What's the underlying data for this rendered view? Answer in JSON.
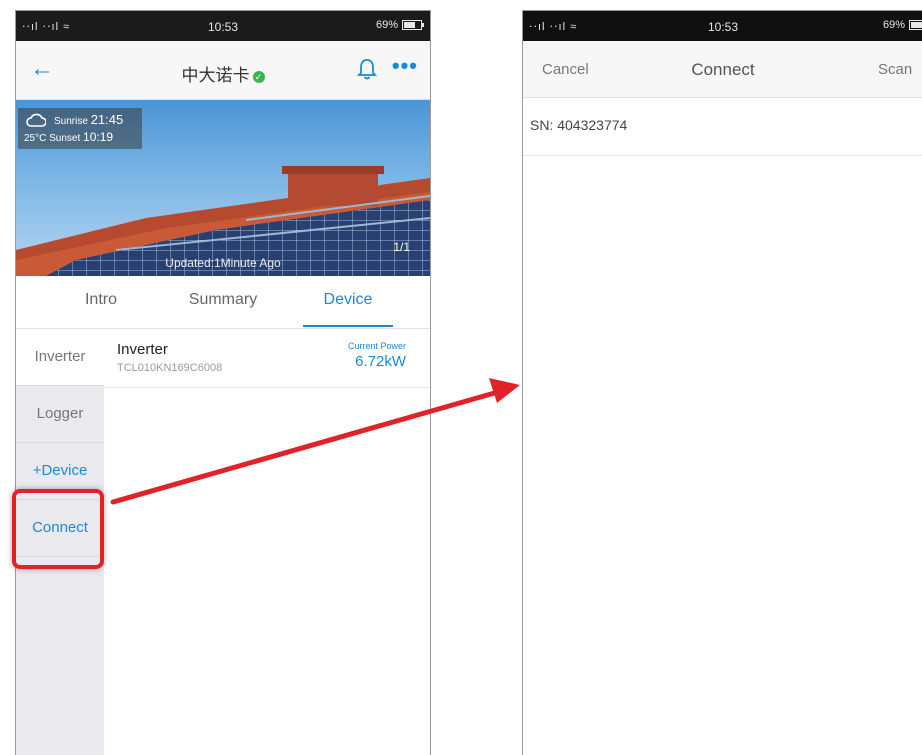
{
  "left_screen": {
    "status": {
      "signal": "‧‧ıl ‧‧ıl ≈",
      "time": "10:53",
      "battery": "69%"
    },
    "header": {
      "title": "中大诺卡"
    },
    "weather": {
      "sunrise_label": "Sunrise",
      "sunrise_time": "21:45",
      "temp": "25°C",
      "sunset_label": "Sunset",
      "sunset_time": "10:19"
    },
    "banner": {
      "updated": "Updated:1Minute Ago",
      "pager": "1/1"
    },
    "tabs": [
      "Intro",
      "Summary",
      "Device"
    ],
    "active_tab": "Device",
    "sidebar": [
      "Inverter",
      "Logger",
      "+Device",
      "Connect"
    ],
    "device": {
      "name": "Inverter",
      "sn": "TCL010KN169C6008",
      "power_label": "Current Power",
      "power_value": "6.72kW"
    }
  },
  "right_screen": {
    "status": {
      "signal": "‧‧ıl ‧‧ıl ≈",
      "time": "10:53",
      "battery": "69%"
    },
    "nav": {
      "cancel": "Cancel",
      "title": "Connect",
      "scan": "Scan"
    },
    "sn": "SN: 404323774"
  },
  "colors": {
    "accent": "#1a8ad8",
    "highlight": "#e1222a",
    "status_bar": "#1b1b1b"
  }
}
